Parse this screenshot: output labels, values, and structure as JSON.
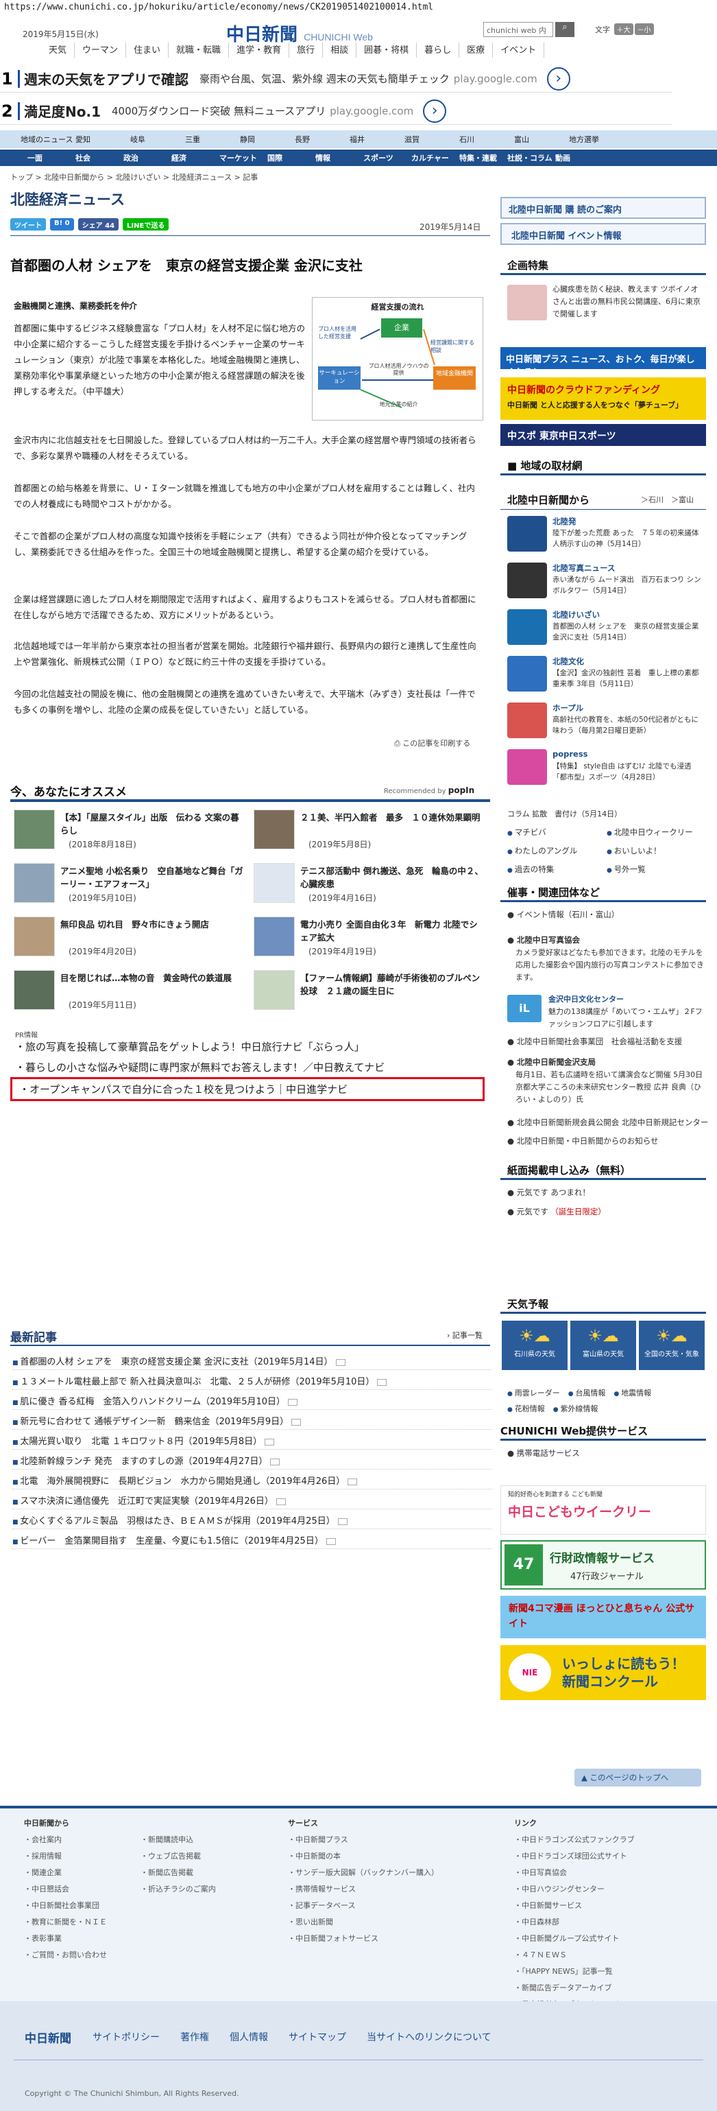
{
  "browser": {
    "url": "https://www.chunichi.co.jp/hokuriku/article/economy/news/CK2019051402100014.html"
  },
  "header": {
    "date": "2019年5月15日(水)",
    "logo": "中日新聞",
    "logo_sub": "CHUNICHI Web",
    "search_placeholder": "chunichi web 内",
    "search_icon": "magnifier-icon",
    "font_label": "文字",
    "font_large": "＋大",
    "font_small": "－小",
    "nav": [
      "天気",
      "ウーマン",
      "住まい",
      "就職・転職",
      "進学・教育",
      "旅行",
      "相談",
      "囲碁・将棋",
      "暮らし",
      "医療",
      "イベント"
    ]
  },
  "ads": [
    {
      "num": "1",
      "head": "週末の天気をアプリで確認",
      "desc": "豪雨や台風、気温、紫外線 週末の天気も簡単チェック",
      "domain": "play.google.com"
    },
    {
      "num": "2",
      "head": "満足度No.1",
      "desc": "4000万ダウンロード突破 無料ニュースアプリ",
      "domain": "play.google.com"
    }
  ],
  "region_nav": [
    "地域のニュース",
    "愛知",
    "岐阜",
    "三重",
    "静岡",
    "長野",
    "福井",
    "滋賀",
    "石川",
    "富山",
    "地方選挙"
  ],
  "category_nav": [
    "一面",
    "社会",
    "政治",
    "経済",
    "マーケット",
    "国際",
    "情報",
    "スポーツ",
    "カルチャー",
    "特集・連載",
    "社説・コラム",
    "動画"
  ],
  "breadcrumb": "トップ > 北陸中日新聞から > 北陸けいざい > 北陸経済ニュース > 記事",
  "section_title": "北陸経済ニュース",
  "share": {
    "tweet": "ツイート",
    "hatena": "B! 0",
    "facebook": "シェア 44",
    "line": "LINEで送る"
  },
  "article": {
    "date": "2019年5月14日",
    "title": "首都圏の人材 シェアを　東京の経営支援企業 金沢に支社",
    "subtitle": "金融機関と連携、業務委託を仲介",
    "paragraphs": [
      "首都圏に集中するビジネス経験豊富な「プロ人材」を人材不足に悩む地方の中小企業に紹介する－こうした経営支援を手掛けるベンチャー企業のサーキュレーション（東京）が北陸で事業を本格化した。地域金融機関と連携し、業務効率化や事業承継といった地方の中小企業が抱える経営課題の解決を後押しする考えだ。（中平雄大）",
      "金沢市内に北信越支社を七日開設した。登録しているプロ人材は約一万二千人。大手企業の経営層や専門領域の技術者らで、多彩な業界や職種の人材をそろえている。",
      "首都圏との給与格差を背景に、Ｕ・Ｉターン就職を推進しても地方の中小企業がプロ人材を雇用することは難しく、社内での人材養成にも時間やコストがかかる。",
      "そこで首都の企業がプロ人材の高度な知識や技術を手軽にシェア（共有）できるよう同社が仲介役となってマッチングし、業務委託できる仕組みを作った。全国三十の地域金融機関と提携し、希望する企業の紹介を受けている。",
      "企業は経営課題に適したプロ人材を期間限定で活用すればよく、雇用するよりもコストを減らせる。プロ人材も首都圏に在住しながら地方で活躍できるため、双方にメリットがあるという。",
      "北信越地域では一年半前から東京本社の担当者が営業を開始。北陸銀行や福井銀行、長野県内の銀行と連携して生産性向上や営業強化、新規株式公開（ＩＰＯ）など既に約三十件の支援を手掛けている。",
      "今回の北信越支社の開設を機に、他の金融機関との連携を進めていきたい考えで、大平瑞木（みずき）支社長は「一件でも多くの事例を増やし、北陸の企業の成長を促していきたい」と話している。"
    ],
    "figure": {
      "title": "経営支援の流れ",
      "node_pro": "プロ人材を活用した経営支援",
      "node_company": "企業",
      "node_issue": "経営課題に関する相談",
      "node_circ": "サーキュレーション",
      "node_bank": "地域金融機関",
      "node_know": "プロ人材活用ノウハウの提供",
      "node_intro": "地元企業の紹介"
    },
    "print": "この記事を印刷する"
  },
  "recommend": {
    "heading": "今、あなたにオススメ",
    "by": "Recommended by",
    "brand": "popIn",
    "items": [
      {
        "title": "【本】「屋屋スタイル」出版　伝わる 文案の暮らし",
        "date": "(2018年8月18日)",
        "thumb": "#6a8a6a"
      },
      {
        "title": "２１美、半円入館者　最多　１０連休効果顕明",
        "date": "(2019年5月8日)",
        "thumb": "#7d6b5a"
      },
      {
        "title": "アニメ聖地 小松名乗り　空自基地など舞台「ガーリー・エアフォース」",
        "date": "(2019年5月10日)",
        "thumb": "#8fa3b8"
      },
      {
        "title": "テニス部活動中 倒れ搬送、急死　輪島の中２、心臓疾患",
        "date": "(2019年4月16日)",
        "thumb": "#dfe6ef"
      },
      {
        "title": "無印良品 切れ目　野々市にきょう開店",
        "date": "(2019年4月20日)",
        "thumb": "#b59b7c"
      },
      {
        "title": "電力小売り 全面自由化３年　新電力 北陸でシェア拡大",
        "date": "(2019年4月19日)",
        "thumb": "#6e8fbf"
      },
      {
        "title": "目を閉じれば…本物の音　黄金時代の鉄道展",
        "date": "(2019年5月11日)",
        "thumb": "#5a6e5a"
      },
      {
        "title": "【ファーム情報網】藤崎が手術後初のブルペン投球　２１歳の誕生日に",
        "date": "",
        "thumb": "#c8d7c0"
      }
    ]
  },
  "pr": {
    "label": "PR情報",
    "items": [
      "旅の写真を投稿して豪華賞品をゲットしよう！中日旅行ナビ「ぶらっ人」",
      "暮らしの小さな悩みや疑問に専門家が無料でお答えします！／中日教えてナビ",
      "オープンキャンパスで自分に合った１校を見つけよう｜中日進学ナビ"
    ]
  },
  "latest": {
    "heading": "最新記事",
    "more": "記事一覧",
    "items": [
      "首都圏の人材 シェアを　東京の経営支援企業 金沢に支社（2019年5月14日）",
      "１３メートル電柱最上部で 新入社員決意叫ぶ　北電、２５人が研修（2019年5月10日）",
      "肌に優き 香る紅梅　金箔入りハンドクリーム（2019年5月10日）",
      "新元号に合わせて 通帳デザイン一新　鶴来信金（2019年5月9日）",
      "太陽光買い取り　北電 １キロワット８円（2019年5月8日）",
      "北陸新幹線ランチ 発売　ますのすしの源（2019年4月27日）",
      "北電　海外展開視野に　長期ビジョン　水力から開始見通し（2019年4月26日）",
      "スマホ決済に通信優先　近江町で実証実験（2019年4月26日）",
      "女心くすぐるアルミ製品　羽根はたき、ＢＥＡＭＳが採用（2019年4月25日）",
      "ビーバー　金箔業開目指す　生産量、今夏にも1.5倍に（2019年4月25日）"
    ]
  },
  "side": {
    "subscribe": "北陸中日新聞 購 読のご案内",
    "event": "北陸中日新聞 イベント情報",
    "kikaku_h": "企画特集",
    "kikaku_text": "心臓疾患を防く秘訣、教えます ツボイノオさんと出雲の無料市民公開講座、6月に東京で開催します",
    "banner_plus": "中日新聞プラス ニュース、おトク、毎日が楽しくなる！",
    "banner_cloud": "中日新聞のクラウドファンディング",
    "banner_cloud_sub": "中日新聞 と人と応援する人をつなぐ「夢チューブ」",
    "banner_sports": "中スポ 東京中日スポーツ",
    "local_h": "地域の取材網",
    "from_h": "北陸中日新聞から",
    "from_links": "＞石川　＞富山",
    "from_items": [
      {
        "tag": "北陸発",
        "text": "陸下が差った荒鹿 あった　７５年の初来議体 人柄示す山の神（5月14日）",
        "color": "#1f4f8c"
      },
      {
        "tag": "北陸写真ニュース",
        "text": "赤い湧ながら ムード演出　百万石まつり シンボルタワー（5月14日）",
        "color": "#333"
      },
      {
        "tag": "北陸けいざい",
        "text": "首都圏の人材 シェアを　東京の経営支援企業 金沢に支社（5月14日）",
        "color": "#1a6fb0"
      },
      {
        "tag": "北陸文化",
        "text": "【金沢】金沢の独創性 芸着　重し上標の素都重来季 3年目（5月11日）",
        "color": "#2f6fbf"
      },
      {
        "tag": "ホープル",
        "text": "高齢社代の教育を、本紙の50代記者がともに味わう（毎月第2日曜日更新）",
        "color": "#d9534f"
      },
      {
        "tag": "popress",
        "text": "【特集】 style自由 はずむI♪ 北陸でも浸透「都市型」スポーツ（4月28日）",
        "color": "#d84aa0"
      }
    ],
    "column": "コラム 拡散　書付け（5月14日）",
    "links": [
      "マチビバ",
      "北陸中日ウィークリー",
      "わたしのアングル",
      "おいしいよ！",
      "過去の特集",
      "号外一覧"
    ],
    "events_h": "催事・関連団体など",
    "event_info": "イベント情報（石川・富山）",
    "photo_h": "北陸中日写真協会",
    "photo_text": "カメラ愛好家はどなたも参加できます。北陸のモチルを応用した撮影会や国内旅行の写真コンテストに参加できます。",
    "culture_h": "金沢中日文化センター",
    "culture_text": "魅力の138講座が「めいてつ・エムザ」２Fファッションフロアに引越します",
    "social": "北陸中日新聞社会事業団　社会福祉活動を支援",
    "kanazawa_h": "北陸中日新聞金沢支局",
    "kanazawa_text": "毎月1日、若も広議時を招いて講演会など開催 5月30日 京都大学こころの未来研究センター教授 広井 良典（ひろい・よしのり）氏",
    "koremon": "北陸中日新聞新規会員公開会 北陸中日新規記センター",
    "oshirase": "北陸中日新聞・中日新聞からのお知らせ",
    "paper_h": "紙面掲載申し込み（無料）",
    "paper_a": "元気です あつまれ！",
    "paper_b": "元気です",
    "paper_b2": "（誕生日限定）",
    "weather_h": "天気予報",
    "weather_cards": [
      "石川県の天気",
      "富山県の天気",
      "全国の天気・気象"
    ],
    "weather_links": [
      "雨雲レーダー",
      "台風情報",
      "地震情報",
      "花粉情報",
      "紫外線情報"
    ],
    "service_h": "CHUNICHI Web提供サービス",
    "service_item": "携帯電話サービス",
    "kodomo": "中日こどもウイークリー",
    "kodomo_sub": "知的好奇心を刺激する こども新聞",
    "teiji": "行財政情報サービス",
    "teiji_sub": "47行政ジャーナル",
    "manga": "新聞4コマ漫画 ほっとひと息ちゃん 公式サイト",
    "contest": "いっしょに読もう！ 新聞コンクール",
    "to_top": "このページのトップへ"
  },
  "footer": {
    "col1_h": "中日新聞から",
    "col1": [
      "会社案内",
      "採用情報",
      "関連企業",
      "中日懇話会",
      "中日新聞社会事業団",
      "教育に新聞を・ＮＩＥ",
      "表彰事業",
      "ご質問・お問い合わせ"
    ],
    "col2": [
      "新聞購読申込",
      "ウェブ広告掲載",
      "新聞広告掲載",
      "折込チラシのご案内"
    ],
    "col3_h": "サービス",
    "col3": [
      "中日新聞プラス",
      "中日新聞の本",
      "サンデー版大図解（バックナンバー購入）",
      "携帯情報サービス",
      "記事データベース",
      "思い出新聞",
      "中日新聞フォトサービス"
    ],
    "col4_h": "リンク",
    "col4": [
      "中日ドラゴンズ公式ファンクラブ",
      "中日ドラゴンズ球団公式サイト",
      "中日写真協会",
      "中日ハウジングセンター",
      "中日新聞サービス",
      "中日森林部",
      "中日新聞グループ公式サイト",
      "４７ＮＥＷＳ",
      "「HAPPY NEWS」記事一覧",
      "新聞広告データアーカイブ",
      "日本記者クラブホームページ"
    ],
    "bar_logo": "中日新聞",
    "bar": [
      "サイトポリシー",
      "著作権",
      "個人情報",
      "サイトマップ",
      "当サイトへのリンクについて"
    ],
    "copyright": "Copyright © The Chunichi Shimbun, All Rights Reserved."
  }
}
